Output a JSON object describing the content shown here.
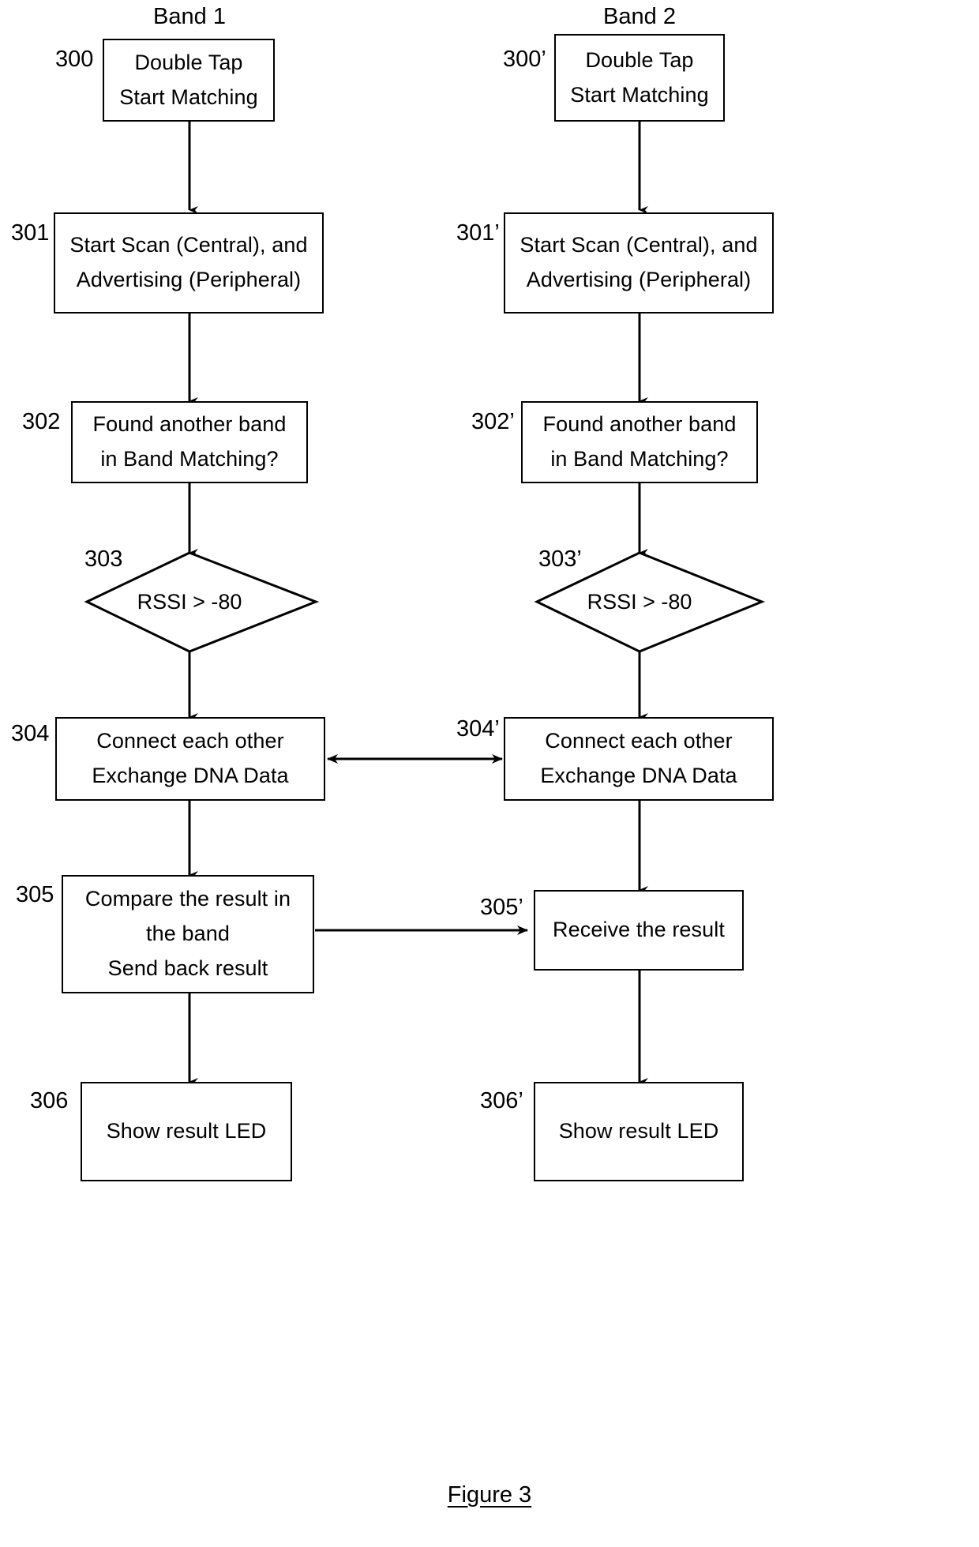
{
  "figure": {
    "caption": "Figure 3",
    "columns": [
      {
        "title": "Band 1"
      },
      {
        "title": "Band 2"
      }
    ]
  },
  "nodes": {
    "n300": {
      "ref": "300",
      "lines": [
        "Double Tap",
        "Start Matching"
      ]
    },
    "n300p": {
      "ref": "300’",
      "lines": [
        "Double Tap",
        "Start Matching"
      ]
    },
    "n301": {
      "ref": "301",
      "lines": [
        "Start Scan (Central), and",
        "Advertising (Peripheral)"
      ]
    },
    "n301p": {
      "ref": "301’",
      "lines": [
        "Start Scan (Central), and",
        "Advertising (Peripheral)"
      ]
    },
    "n302": {
      "ref": "302",
      "lines": [
        "Found another band",
        "in Band Matching?"
      ]
    },
    "n302p": {
      "ref": "302’",
      "lines": [
        "Found another band",
        "in Band Matching?"
      ]
    },
    "n303": {
      "ref": "303",
      "lines": [
        "RSSI > -80"
      ]
    },
    "n303p": {
      "ref": "303’",
      "lines": [
        "RSSI > -80"
      ]
    },
    "n304": {
      "ref": "304",
      "lines": [
        "Connect each other",
        "Exchange DNA Data"
      ]
    },
    "n304p": {
      "ref": "304’",
      "lines": [
        "Connect each other",
        "Exchange DNA Data"
      ]
    },
    "n305": {
      "ref": "305",
      "lines": [
        "Compare the result in",
        "the band",
        "Send back result"
      ]
    },
    "n305p": {
      "ref": "305’",
      "lines": [
        "Receive the result"
      ]
    },
    "n306": {
      "ref": "306",
      "lines": [
        "Show result LED"
      ]
    },
    "n306p": {
      "ref": "306’",
      "lines": [
        "Show result LED"
      ]
    }
  },
  "colors": {
    "stroke": "#000000",
    "background": "#ffffff"
  }
}
